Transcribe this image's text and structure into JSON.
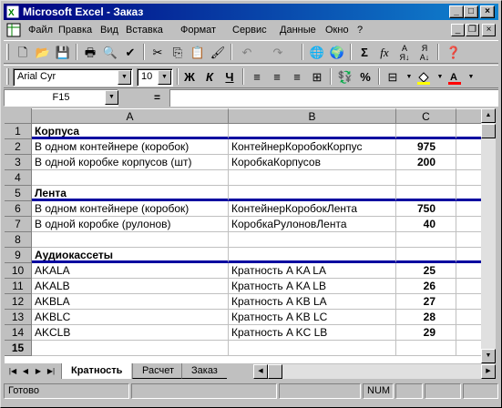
{
  "window": {
    "title": "Microsoft Excel - Заказ"
  },
  "menu": {
    "items": [
      "Файл",
      "Правка",
      "Вид",
      "Вставка",
      "Формат",
      "Сервис",
      "Данные",
      "Окно",
      "?"
    ]
  },
  "format_toolbar": {
    "font": "Arial Cyr",
    "size": "10",
    "bold": "Ж",
    "italic": "К",
    "underline": "Ч",
    "percent": "%"
  },
  "formula_bar": {
    "name_box": "F15",
    "equals": "=",
    "formula": ""
  },
  "grid": {
    "columns": [
      "A",
      "B",
      "C"
    ],
    "rows": [
      {
        "n": "1",
        "a": "Корпуса",
        "b": "",
        "c": ""
      },
      {
        "n": "2",
        "a": "В одном контейнере (коробок)",
        "b": "КонтейнерКоробокКорпус",
        "c": "975"
      },
      {
        "n": "3",
        "a": "В одной коробке корпусов (шт)",
        "b": "КоробкаКорпусов",
        "c": "200"
      },
      {
        "n": "4",
        "a": "",
        "b": "",
        "c": ""
      },
      {
        "n": "5",
        "a": "Лента",
        "b": "",
        "c": ""
      },
      {
        "n": "6",
        "a": "В одном контейнере (коробок)",
        "b": "КонтейнерКоробокЛента",
        "c": "750"
      },
      {
        "n": "7",
        "a": "В одной коробке (рулонов)",
        "b": "КоробкаРулоновЛента",
        "c": "40"
      },
      {
        "n": "8",
        "a": "",
        "b": "",
        "c": ""
      },
      {
        "n": "9",
        "a": "Аудиокассеты",
        "b": "",
        "c": ""
      },
      {
        "n": "10",
        "a": "AKALA",
        "b": "Кратность A KA LA",
        "c": "25"
      },
      {
        "n": "11",
        "a": "AKALB",
        "b": "Кратность A KA LB",
        "c": "26"
      },
      {
        "n": "12",
        "a": "AKBLA",
        "b": "Кратность A KB LA",
        "c": "27"
      },
      {
        "n": "13",
        "a": "AKBLC",
        "b": "Кратность A KB LC",
        "c": "28"
      },
      {
        "n": "14",
        "a": "AKCLB",
        "b": "Кратность A KC LB",
        "c": "29"
      },
      {
        "n": "15",
        "a": "",
        "b": "",
        "c": ""
      }
    ]
  },
  "sheet_tabs": [
    "Кратность",
    "Расчет",
    "Заказ"
  ],
  "status": {
    "text": "Готово",
    "num": "NUM"
  },
  "colors": {
    "title_bar": "#000080",
    "section_line": "#0000a0",
    "window_bg": "#c0c0c0"
  }
}
